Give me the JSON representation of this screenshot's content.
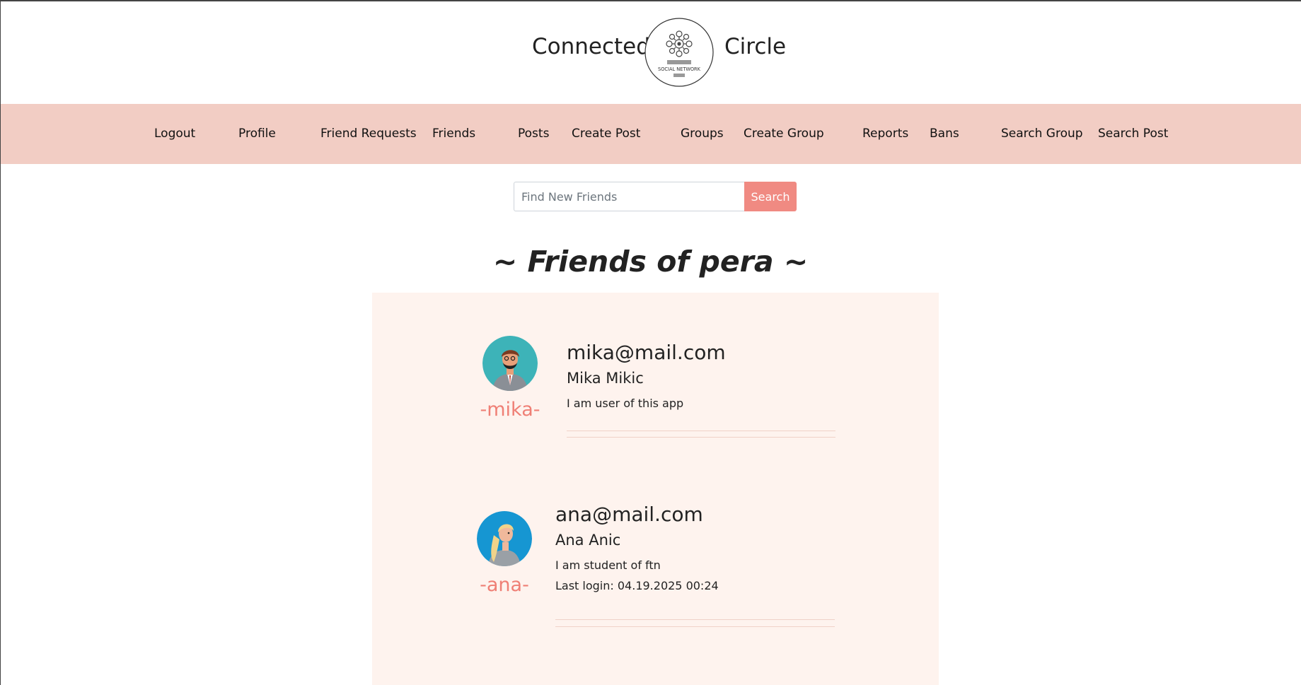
{
  "brand": {
    "left": "Connected",
    "right": "Circle",
    "logo_caption": "SOCIAL NETWORK"
  },
  "nav": [
    {
      "id": "logout",
      "label": "Logout"
    },
    {
      "id": "profile",
      "label": "Profile"
    },
    {
      "id": "friend-requests",
      "label": "Friend Requests"
    },
    {
      "id": "friends",
      "label": "Friends"
    },
    {
      "id": "posts",
      "label": "Posts"
    },
    {
      "id": "create-post",
      "label": "Create Post"
    },
    {
      "id": "groups",
      "label": "Groups"
    },
    {
      "id": "create-group",
      "label": "Create Group"
    },
    {
      "id": "reports",
      "label": "Reports"
    },
    {
      "id": "bans",
      "label": "Bans"
    },
    {
      "id": "search-group",
      "label": "Search Group"
    },
    {
      "id": "search-post",
      "label": "Search Post"
    }
  ],
  "search": {
    "placeholder": "Find New Friends",
    "value": "",
    "button": "Search"
  },
  "page_title": "~ Friends of pera ~",
  "friends": [
    {
      "email": "mika@mail.com",
      "name": "Mika Mikic",
      "username": "-mika-",
      "bio": "I am user of this app",
      "last_login": ""
    },
    {
      "email": "ana@mail.com",
      "name": "Ana Anic",
      "username": "-ana-",
      "bio": "I am student of ftn",
      "last_login": "Last login: 04.19.2025 00:24"
    }
  ],
  "colors": {
    "nav_bg": "#f2cdc4",
    "accent": "#f08a82",
    "panel_bg": "#fef3ee",
    "username": "#ef7f75"
  },
  "icons": {
    "logo": "social-network-logo-icon",
    "friend_avatar": "person-avatar-icon"
  }
}
